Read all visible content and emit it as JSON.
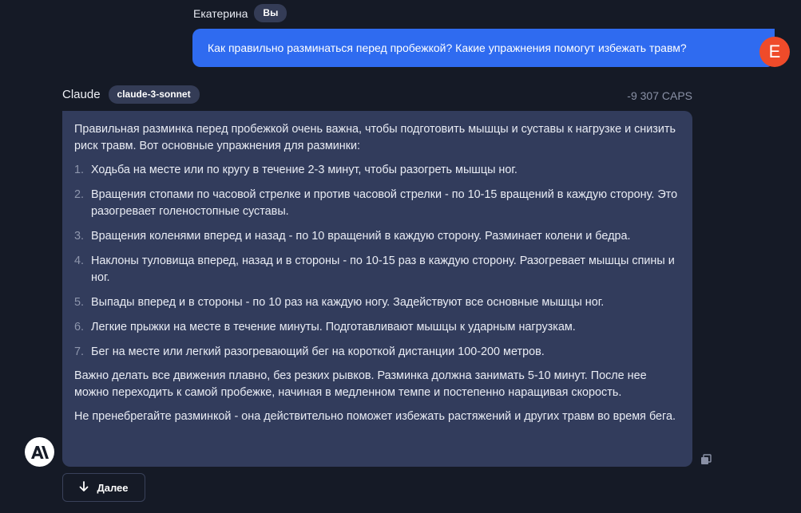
{
  "user_message": {
    "author": "Екатерина",
    "badge": "Вы",
    "text": "Как правильно разминаться перед пробежкой? Какие упражнения помогут избежать травм?",
    "avatar_letter": "E"
  },
  "assistant_message": {
    "author": "Claude",
    "model_badge": "claude-3-sonnet",
    "caps": "-9 307 CAPS",
    "intro": "Правильная разминка перед пробежкой очень важна, чтобы подготовить мышцы и суставы к нагрузке и снизить риск травм. Вот основные упражнения для разминки:",
    "items": [
      {
        "num": "1.",
        "text": "Ходьба на месте или по кругу в течение 2-3 минут, чтобы разогреть мышцы ног."
      },
      {
        "num": "2.",
        "text": "Вращения стопами по часовой стрелке и против часовой стрелки - по 10-15 вращений в каждую сторону. Это разогревает голеностопные суставы."
      },
      {
        "num": "3.",
        "text": "Вращения коленями вперед и назад - по 10 вращений в каждую сторону. Разминает колени и бедра."
      },
      {
        "num": "4.",
        "text": "Наклоны туловища вперед, назад и в стороны - по 10-15 раз в каждую сторону. Разогревает мышцы спины и ног."
      },
      {
        "num": "5.",
        "text": "Выпады вперед и в стороны - по 10 раз на каждую ногу. Задействуют все основные мышцы ног."
      },
      {
        "num": "6.",
        "text": "Легкие прыжки на месте в течение минуты. Подготавливают мышцы к ударным нагрузкам."
      },
      {
        "num": "7.",
        "text": "Бег на месте или легкий разогревающий бег на короткой дистанции 100-200 метров."
      }
    ],
    "outro_1": "Важно делать все движения плавно, без резких рывков. Разминка должна занимать 5-10 минут. После нее можно переходить к самой пробежке, начиная в медленном темпе и постепенно наращивая скорость.",
    "outro_2": "Не пренебрегайте разминкой - она действительно поможет избежать растяжений и других травм во время бега."
  },
  "next_button": {
    "label": "Далее",
    "icon": "arrow-down-icon"
  },
  "icons": {
    "assistant_avatar": "anthropic-logo-icon",
    "copy": "copy-icon"
  },
  "colors": {
    "background": "#151a26",
    "user_bubble": "#2f6bf0",
    "assistant_bubble": "#323c5c",
    "user_avatar": "#ef4b2a",
    "badge": "#343c56"
  }
}
